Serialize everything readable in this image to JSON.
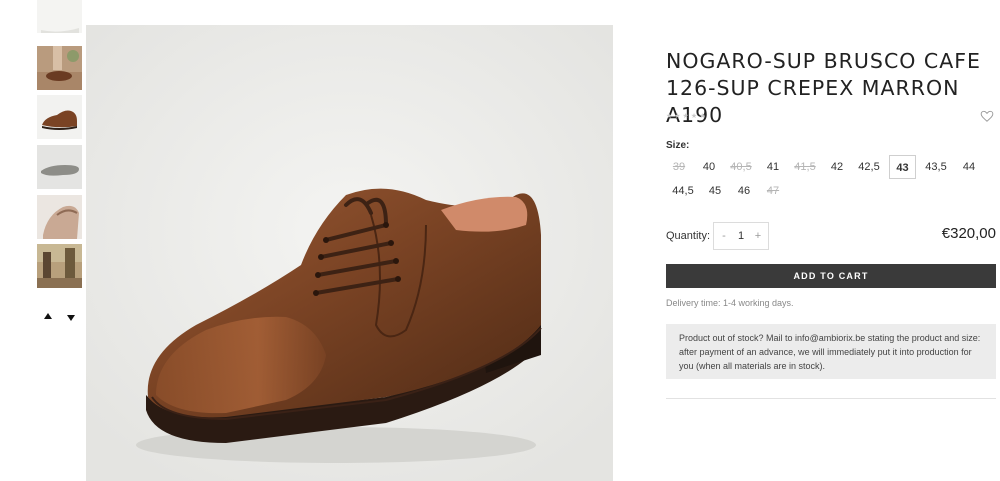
{
  "product": {
    "title": "NOGARO-SUP BRUSCO CAFE 126-SUP CREPEX MARRON A190",
    "rating_stars": "★★★★★",
    "price": "€320,00"
  },
  "thumbnails": [
    {
      "name": "thumb-shoe-white"
    },
    {
      "name": "thumb-shoe-outdoor"
    },
    {
      "name": "thumb-shoe-side"
    },
    {
      "name": "thumb-shoe-sole"
    },
    {
      "name": "thumb-shoe-detail"
    },
    {
      "name": "thumb-shoe-lifestyle"
    }
  ],
  "size": {
    "label": "Size:",
    "options": [
      {
        "label": "39",
        "available": false,
        "selected": false
      },
      {
        "label": "40",
        "available": true,
        "selected": false
      },
      {
        "label": "40,5",
        "available": false,
        "selected": false
      },
      {
        "label": "41",
        "available": true,
        "selected": false
      },
      {
        "label": "41,5",
        "available": false,
        "selected": false
      },
      {
        "label": "42",
        "available": true,
        "selected": false
      },
      {
        "label": "42,5",
        "available": true,
        "selected": false
      },
      {
        "label": "43",
        "available": true,
        "selected": true
      },
      {
        "label": "43,5",
        "available": true,
        "selected": false
      },
      {
        "label": "44",
        "available": true,
        "selected": false
      },
      {
        "label": "44,5",
        "available": true,
        "selected": false
      },
      {
        "label": "45",
        "available": true,
        "selected": false
      },
      {
        "label": "46",
        "available": true,
        "selected": false
      },
      {
        "label": "47",
        "available": false,
        "selected": false
      }
    ]
  },
  "quantity": {
    "label": "Quantity:",
    "value": "1",
    "minus": "-",
    "plus": "+"
  },
  "cart": {
    "button_label": "ADD TO CART"
  },
  "delivery_text": "Delivery time: 1-4 working days.",
  "stock_notice": "Product out of stock? Mail to info@ambiorix.be stating the product and size: after payment of an advance, we will immediately put it into production for you (when all materials are in stock).",
  "colors": {
    "button_bg": "#3a3a3a",
    "notice_bg": "#ececec",
    "shoe_leather": "#7a4324"
  }
}
